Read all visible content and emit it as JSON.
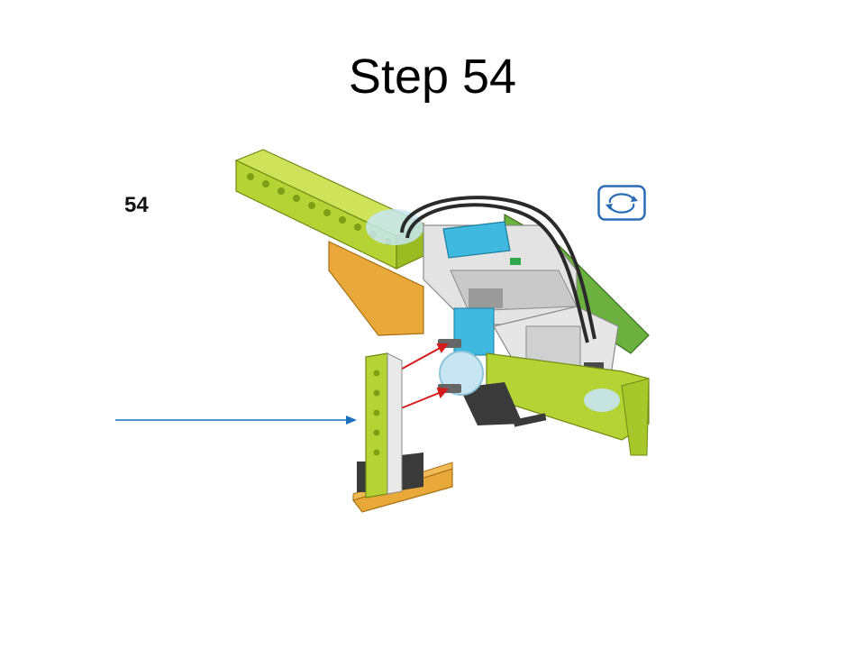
{
  "slide": {
    "title": "Step 54"
  },
  "instruction": {
    "step_number": "54",
    "rotate_icon": "rotate-model-icon",
    "colors": {
      "lime": "#b5d334",
      "dark_lime": "#8fb020",
      "orange": "#e8a93a",
      "light_gray": "#d9d9d9",
      "azure": "#3fb9df",
      "trans_clear": "#c7e6f2",
      "cable": "#2a2a2a",
      "arrow_red": "#d51b1b",
      "pointer_blue": "#1f6fbf",
      "rotate_blue": "#2a6db5"
    }
  }
}
